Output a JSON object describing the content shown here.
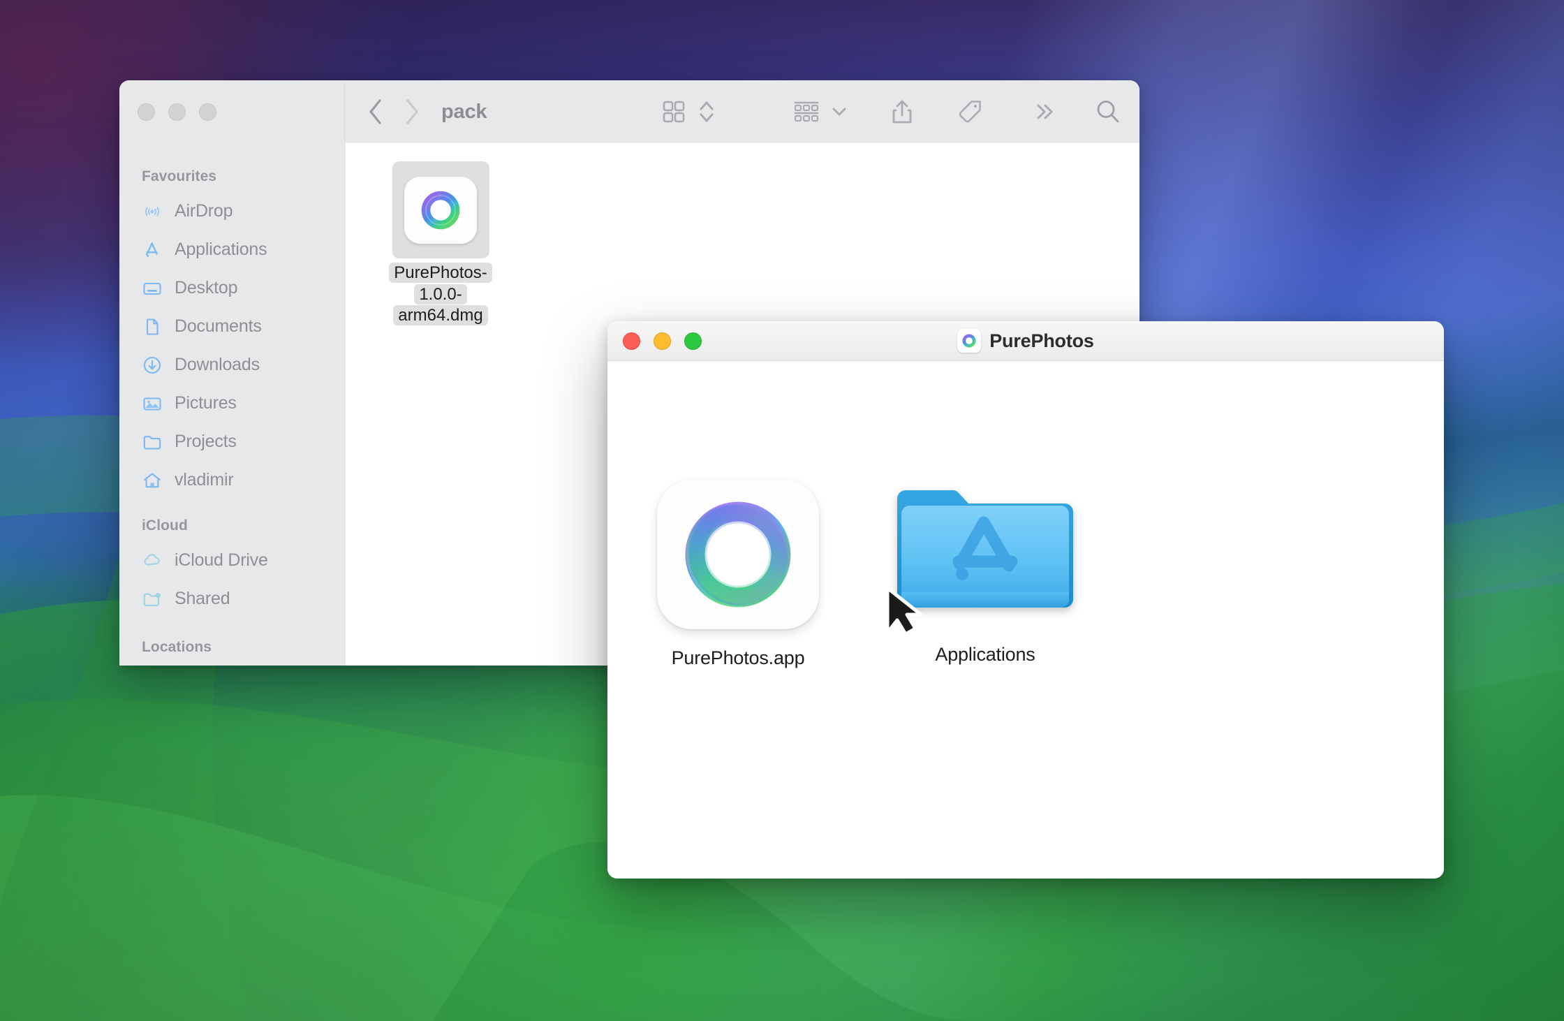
{
  "desktop": {
    "wallpaper_name": "macos-sonoma-gradient",
    "colors": {
      "top_left": "#3b2a63",
      "magenta": "#60285c",
      "blue": "#4065c9",
      "teal": "#0c526e",
      "green": "#36ab46"
    }
  },
  "finder_window": {
    "name": "finder",
    "active": false,
    "path_title": "pack",
    "traffic_lights": [
      {
        "name": "close",
        "label": "Close"
      },
      {
        "name": "minimize",
        "label": "Minimize"
      },
      {
        "name": "zoom",
        "label": "Zoom"
      }
    ],
    "toolbar": {
      "back_label": "Back",
      "forward_label": "Forward",
      "icon_view_label": "Icon view",
      "view_stepper_label": "Change view",
      "group_label": "Group items",
      "group_chevron_label": "Group options",
      "share_label": "Share",
      "tag_label": "Tags",
      "more_label": "More toolbar items",
      "search_label": "Search"
    },
    "sidebar": {
      "sections": [
        {
          "title": "Favourites",
          "items": [
            {
              "icon": "airdrop-icon",
              "label": "AirDrop"
            },
            {
              "icon": "applications-icon",
              "label": "Applications"
            },
            {
              "icon": "desktop-icon",
              "label": "Desktop"
            },
            {
              "icon": "documents-icon",
              "label": "Documents"
            },
            {
              "icon": "downloads-icon",
              "label": "Downloads"
            },
            {
              "icon": "pictures-icon",
              "label": "Pictures"
            },
            {
              "icon": "folder-icon",
              "label": "Projects"
            },
            {
              "icon": "home-icon",
              "label": "vladimir"
            }
          ]
        },
        {
          "title": "iCloud",
          "items": [
            {
              "icon": "cloud-icon",
              "label": "iCloud Drive"
            },
            {
              "icon": "shared-folder-icon",
              "label": "Shared"
            }
          ]
        },
        {
          "title": "Locations",
          "items": []
        }
      ]
    },
    "files": [
      {
        "name": "dmg-file",
        "label": "PurePhotos-1.0.0-arm64.dmg",
        "label_line1": "PurePhotos-1.0.0-",
        "label_line2": "arm64.dmg",
        "selected": true,
        "icon": "purephotos-app-icon"
      }
    ]
  },
  "dmg_window": {
    "name": "purephotos-dmg",
    "active": true,
    "title": "PurePhotos",
    "title_icon": "purephotos-app-icon",
    "traffic_lights": [
      {
        "name": "close",
        "label": "Close"
      },
      {
        "name": "minimize",
        "label": "Minimize"
      },
      {
        "name": "zoom",
        "label": "Zoom"
      }
    ],
    "items": [
      {
        "name": "purephotos-app",
        "label": "PurePhotos.app",
        "icon": "purephotos-app-icon"
      },
      {
        "name": "applications-folder-alias",
        "label": "Applications",
        "icon": "applications-folder-icon",
        "badge": "alias-arrow-icon"
      }
    ]
  }
}
